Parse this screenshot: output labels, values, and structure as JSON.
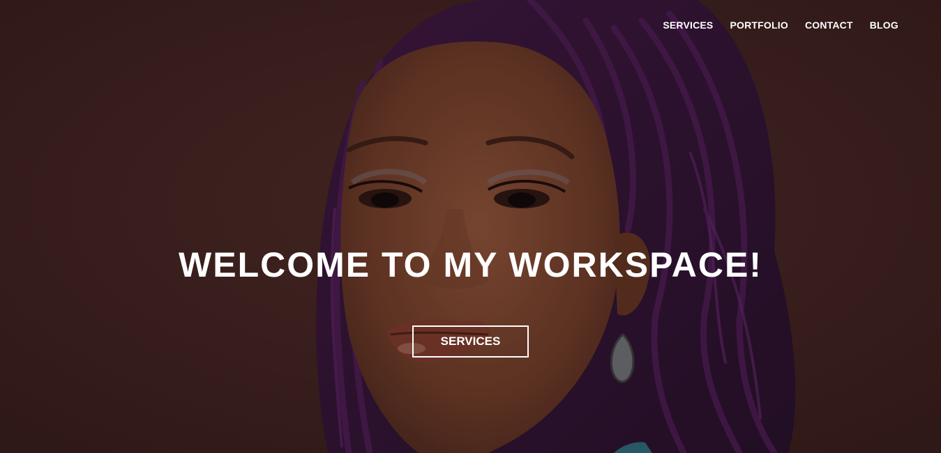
{
  "nav": {
    "items": [
      {
        "label": "SERVICES"
      },
      {
        "label": "PORTFOLIO"
      },
      {
        "label": "CONTACT"
      },
      {
        "label": "BLOG"
      }
    ]
  },
  "hero": {
    "headline": "WELCOME TO MY WORKSPACE!",
    "cta_label": "SERVICES"
  },
  "colors": {
    "background": "#3d2220",
    "text": "#ffffff"
  }
}
